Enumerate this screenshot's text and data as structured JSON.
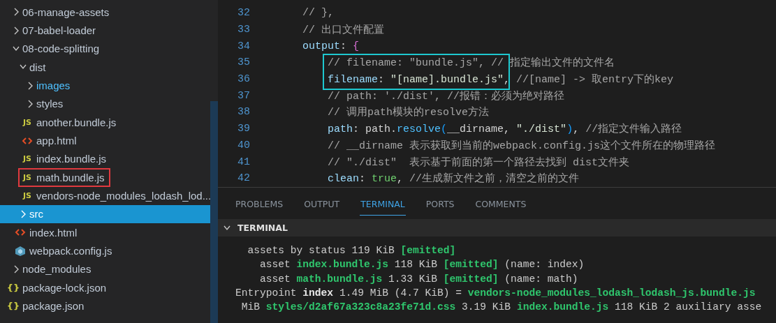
{
  "explorer": {
    "items": [
      {
        "label": "06-manage-assets",
        "kind": "folder",
        "expanded": false,
        "selected": false
      },
      {
        "label": "07-babel-loader",
        "kind": "folder",
        "expanded": false,
        "selected": false
      },
      {
        "label": "08-code-splitting",
        "kind": "folder",
        "expanded": true,
        "selected": false,
        "children": [
          {
            "label": "dist",
            "kind": "folder",
            "expanded": true,
            "selected": false,
            "children": [
              {
                "label": "images",
                "kind": "folder",
                "expanded": false,
                "selected": false,
                "color": "#4fc1ff"
              },
              {
                "label": "styles",
                "kind": "folder",
                "expanded": false,
                "selected": false
              },
              {
                "label": "another.bundle.js",
                "kind": "js",
                "icon": "JS",
                "selected": false
              },
              {
                "label": "app.html",
                "kind": "html",
                "selected": false
              },
              {
                "label": "index.bundle.js",
                "kind": "js",
                "icon": "JS",
                "selected": false
              },
              {
                "label": "math.bundle.js",
                "kind": "js",
                "icon": "JS",
                "selected": false,
                "annotated": true
              },
              {
                "label": "vendors-node_modules_lodash_lod...",
                "kind": "js",
                "icon": "JS",
                "selected": false
              }
            ]
          },
          {
            "label": "src",
            "kind": "folder",
            "expanded": false,
            "selected": true
          },
          {
            "label": "index.html",
            "kind": "html",
            "selected": false
          },
          {
            "label": "webpack.config.js",
            "kind": "webpack",
            "selected": false
          }
        ]
      },
      {
        "label": "node_modules",
        "kind": "folder",
        "expanded": false,
        "selected": false
      },
      {
        "label": "package-lock.json",
        "kind": "json",
        "icon": "{}",
        "selected": false
      },
      {
        "label": "package.json",
        "kind": "json",
        "icon": "{}",
        "selected": false
      }
    ]
  },
  "editor": {
    "lines": [
      {
        "number": "32",
        "tokens": [
          {
            "kind": "comment",
            "text": "    // },"
          }
        ]
      },
      {
        "number": "33",
        "tokens": [
          {
            "kind": "comment",
            "text": "    // 出口文件配置"
          }
        ]
      },
      {
        "number": "34",
        "tokens": [
          {
            "kind": "key",
            "text": "    output"
          },
          {
            "kind": "plain",
            "text": ": "
          },
          {
            "kind": "brace",
            "text": "{"
          }
        ]
      },
      {
        "number": "35",
        "annotated": true,
        "tokens": [
          {
            "kind": "comment",
            "text": "        // filename: \"bundle.js\", // 指定输出文件的文件名"
          }
        ]
      },
      {
        "number": "36",
        "annotated": true,
        "tokens": [
          {
            "kind": "key",
            "text": "        filename"
          },
          {
            "kind": "plain",
            "text": ": "
          },
          {
            "kind": "string",
            "text": "\"[name].bundle.js\""
          },
          {
            "kind": "plain",
            "text": ", "
          },
          {
            "kind": "comment",
            "text": "//[name] -> 取entry下的key"
          }
        ]
      },
      {
        "number": "37",
        "tokens": [
          {
            "kind": "comment",
            "text": "        // path: './dist', //报错：必须为绝对路径"
          }
        ]
      },
      {
        "number": "38",
        "tokens": [
          {
            "kind": "comment",
            "text": "        // 调用path模块的resolve方法"
          }
        ]
      },
      {
        "number": "39",
        "tokens": [
          {
            "kind": "key",
            "text": "        path"
          },
          {
            "kind": "plain",
            "text": ": path."
          },
          {
            "kind": "function",
            "text": "resolve"
          },
          {
            "kind": "paren",
            "text": "("
          },
          {
            "kind": "plain",
            "text": "__dirname, "
          },
          {
            "kind": "string",
            "text": "\"./dist\""
          },
          {
            "kind": "paren",
            "text": ")"
          },
          {
            "kind": "plain",
            "text": ", "
          },
          {
            "kind": "comment",
            "text": "//指定文件输入路径"
          }
        ]
      },
      {
        "number": "40",
        "tokens": [
          {
            "kind": "comment",
            "text": "        // __dirname 表示获取到当前的webpack.config.js这个文件所在的物理路径"
          }
        ]
      },
      {
        "number": "41",
        "tokens": [
          {
            "kind": "comment",
            "text": "        // \"./dist\"  表示基于前面的第一个路径去找到 dist文件夹"
          }
        ]
      },
      {
        "number": "42",
        "tokens": [
          {
            "kind": "key",
            "text": "        clean"
          },
          {
            "kind": "plain",
            "text": ": "
          },
          {
            "kind": "bool",
            "text": "true"
          },
          {
            "kind": "plain",
            "text": ", "
          },
          {
            "kind": "comment",
            "text": "//生成新文件之前，清空之前的文件"
          }
        ]
      }
    ]
  },
  "panel": {
    "tabs": [
      {
        "label": "PROBLEMS",
        "selected": false
      },
      {
        "label": "OUTPUT",
        "selected": false
      },
      {
        "label": "TERMINAL",
        "selected": true
      },
      {
        "label": "PORTS",
        "selected": false
      },
      {
        "label": "COMMENTS",
        "selected": false
      }
    ],
    "section_title": "TERMINAL",
    "expanded": true,
    "terminal_lines": [
      {
        "tokens": [
          {
            "kind": "plain",
            "text": "  assets by status 119 KiB "
          },
          {
            "kind": "green",
            "text": "[emitted]"
          }
        ]
      },
      {
        "tokens": [
          {
            "kind": "plain",
            "text": "    asset "
          },
          {
            "kind": "green",
            "text": "index.bundle.js"
          },
          {
            "kind": "plain",
            "text": " 118 KiB "
          },
          {
            "kind": "green",
            "text": "[emitted]"
          },
          {
            "kind": "plain",
            "text": " (name: index)"
          }
        ]
      },
      {
        "tokens": [
          {
            "kind": "plain",
            "text": "    asset "
          },
          {
            "kind": "green",
            "text": "math.bundle.js"
          },
          {
            "kind": "plain",
            "text": " 1.33 KiB "
          },
          {
            "kind": "green",
            "text": "[emitted]"
          },
          {
            "kind": "plain",
            "text": " (name: math)"
          }
        ]
      },
      {
        "tokens": [
          {
            "kind": "plain",
            "text": "Entrypoint "
          },
          {
            "kind": "bold",
            "text": "index"
          },
          {
            "kind": "plain",
            "text": " 1.49 MiB (4.7 KiB) = "
          },
          {
            "kind": "green",
            "text": "vendors-node_modules_lodash_lodash_js.bundle.js"
          }
        ]
      },
      {
        "tokens": [
          {
            "kind": "plain",
            "text": " MiB "
          },
          {
            "kind": "green",
            "text": "styles/d2af67a323c8a23fe71d.css"
          },
          {
            "kind": "plain",
            "text": " 3.19 KiB "
          },
          {
            "kind": "green",
            "text": "index.bundle.js"
          },
          {
            "kind": "plain",
            "text": " 118 KiB 2 auxiliary asse"
          }
        ]
      }
    ]
  }
}
